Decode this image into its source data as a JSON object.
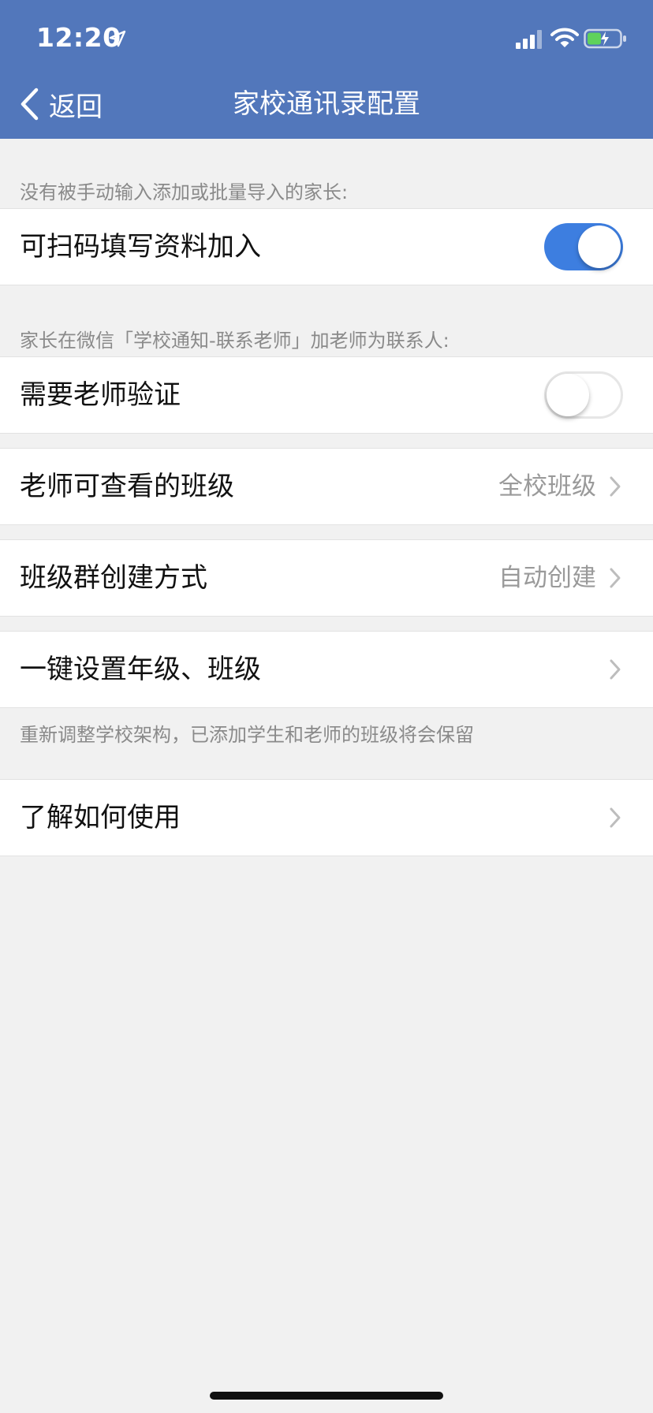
{
  "status_bar": {
    "time": "12:20"
  },
  "nav": {
    "back_label": "返回",
    "title": "家校通讯录配置"
  },
  "sections": {
    "scan_caption": "没有被手动输入添加或批量导入的家长:",
    "scan_join": {
      "label": "可扫码填写资料加入",
      "switch_on": true
    },
    "wechat_caption": "家长在微信「学校通知-联系老师」加老师为联系人:",
    "teacher_verify": {
      "label": "需要老师验证",
      "switch_on": false
    },
    "visible_classes": {
      "label": "老师可查看的班级",
      "value": "全校班级"
    },
    "group_creation": {
      "label": "班级群创建方式",
      "value": "自动创建"
    },
    "one_key_setup": {
      "label": "一键设置年级、班级"
    },
    "setup_caption": "重新调整学校架构，已添加学生和老师的班级将会保留",
    "how_to_use": {
      "label": "了解如何使用"
    }
  },
  "colors": {
    "header": "#5277bb",
    "switch_on": "#3d7ee0",
    "background": "#f1f1f1"
  }
}
